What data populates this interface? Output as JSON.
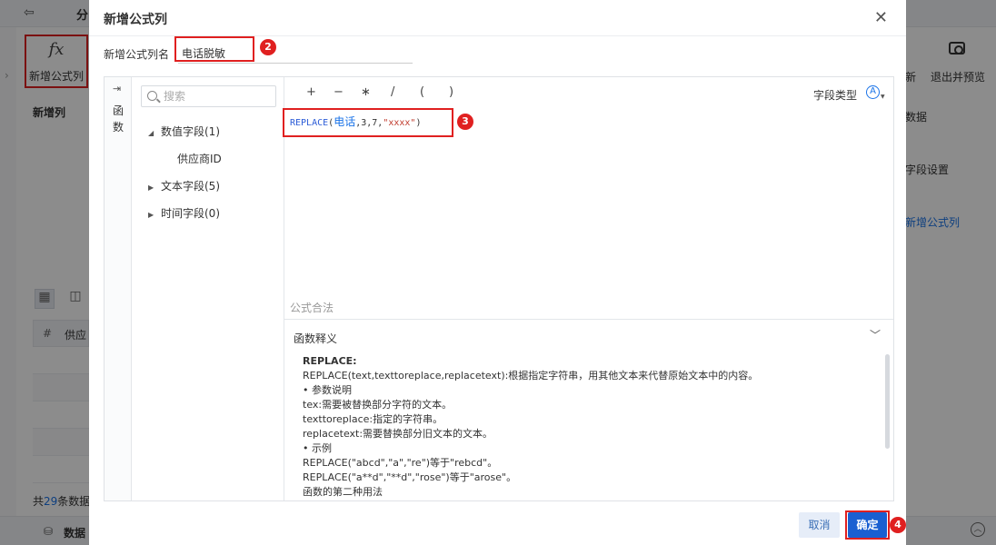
{
  "background": {
    "tab_label": "分",
    "formula_button_label": "新增公式列",
    "new_col_title": "新增列",
    "grid_col_label": "供应",
    "count_prefix": "共",
    "count_value": "29",
    "count_suffix": "条数据",
    "bottom_label": "数据",
    "right_new": "新",
    "right_preview": "退出并预览",
    "right_item1": "数据",
    "right_item2": "字段设置",
    "right_item3": "新增公式列"
  },
  "modal": {
    "title": "新增公式列",
    "name_label": "新增公式列名",
    "name_value": "电话脱敏",
    "fn_tab": "函数",
    "search_placeholder": "搜索",
    "tree": [
      {
        "label": "数值字段(1)",
        "expanded": true,
        "children": [
          "供应商ID"
        ]
      },
      {
        "label": "文本字段(5)",
        "expanded": false
      },
      {
        "label": "时间字段(0)",
        "expanded": false
      }
    ],
    "operators": [
      "+",
      "−",
      "∗",
      "/",
      "(",
      ")"
    ],
    "field_type_label": "字段类型",
    "formula": {
      "fn": "REPLACE",
      "field": "电话",
      "args": ",3,7,",
      "str": "\"xxxx\""
    },
    "validity": "公式合法",
    "desc_title": "函数释义",
    "desc_lines": [
      "REPLACE:",
      "REPLACE(text,texttoreplace,replacetext):根据指定字符串，用其他文本来代替原始文本中的内容。",
      "• 参数说明",
      "tex:需要被替换部分字符的文本。",
      "texttoreplace:指定的字符串。",
      "replacetext:需要替换部分旧文本的文本。",
      "• 示例",
      "REPLACE(\"abcd\",\"a\",\"re\")等于\"rebcd\"。",
      "REPLACE(\"a**d\",\"**d\",\"rose\")等于\"arose\"。",
      "函数的第二种用法"
    ],
    "cancel_label": "取消",
    "ok_label": "确定"
  },
  "callouts": [
    "1",
    "2",
    "3",
    "4"
  ],
  "colors": {
    "accent": "#1a5fd1",
    "highlight": "#e02020"
  }
}
